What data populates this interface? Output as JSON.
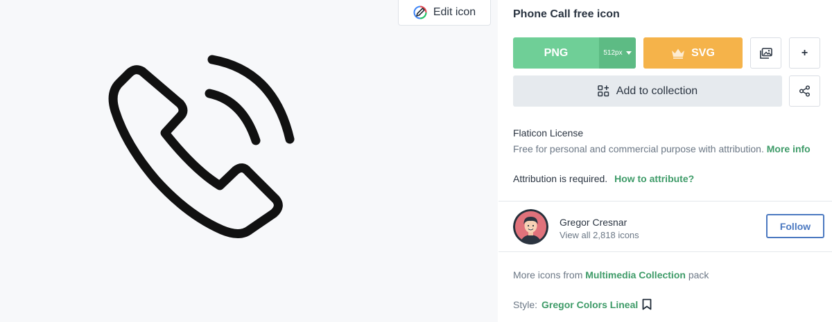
{
  "preview": {
    "edit_button_label": "Edit icon",
    "icon_name": "phone-call-icon"
  },
  "detail": {
    "title": "Phone Call free icon",
    "png_label": "PNG",
    "png_size": "512px",
    "svg_label": "SVG",
    "plus_label": "+",
    "collection_label": "Add to collection",
    "license_title": "Flaticon License",
    "license_text": "Free for personal and commercial purpose with attribution.",
    "license_link": "More info",
    "attribution_text": "Attribution is required.",
    "attribution_link": "How to attribute?",
    "author_name": "Gregor Cresnar",
    "author_sub": "View all 2,818 icons",
    "follow_label": "Follow",
    "more_prefix": "More icons from",
    "more_link": "Multimedia Collection",
    "more_suffix": "pack",
    "style_label": "Style:",
    "style_link": "Gregor Colors Lineal"
  },
  "colors": {
    "png_green": "#6fcf97",
    "svg_orange": "#f5b34a",
    "link_green": "#3e9b68",
    "follow_blue": "#4a78c0"
  }
}
